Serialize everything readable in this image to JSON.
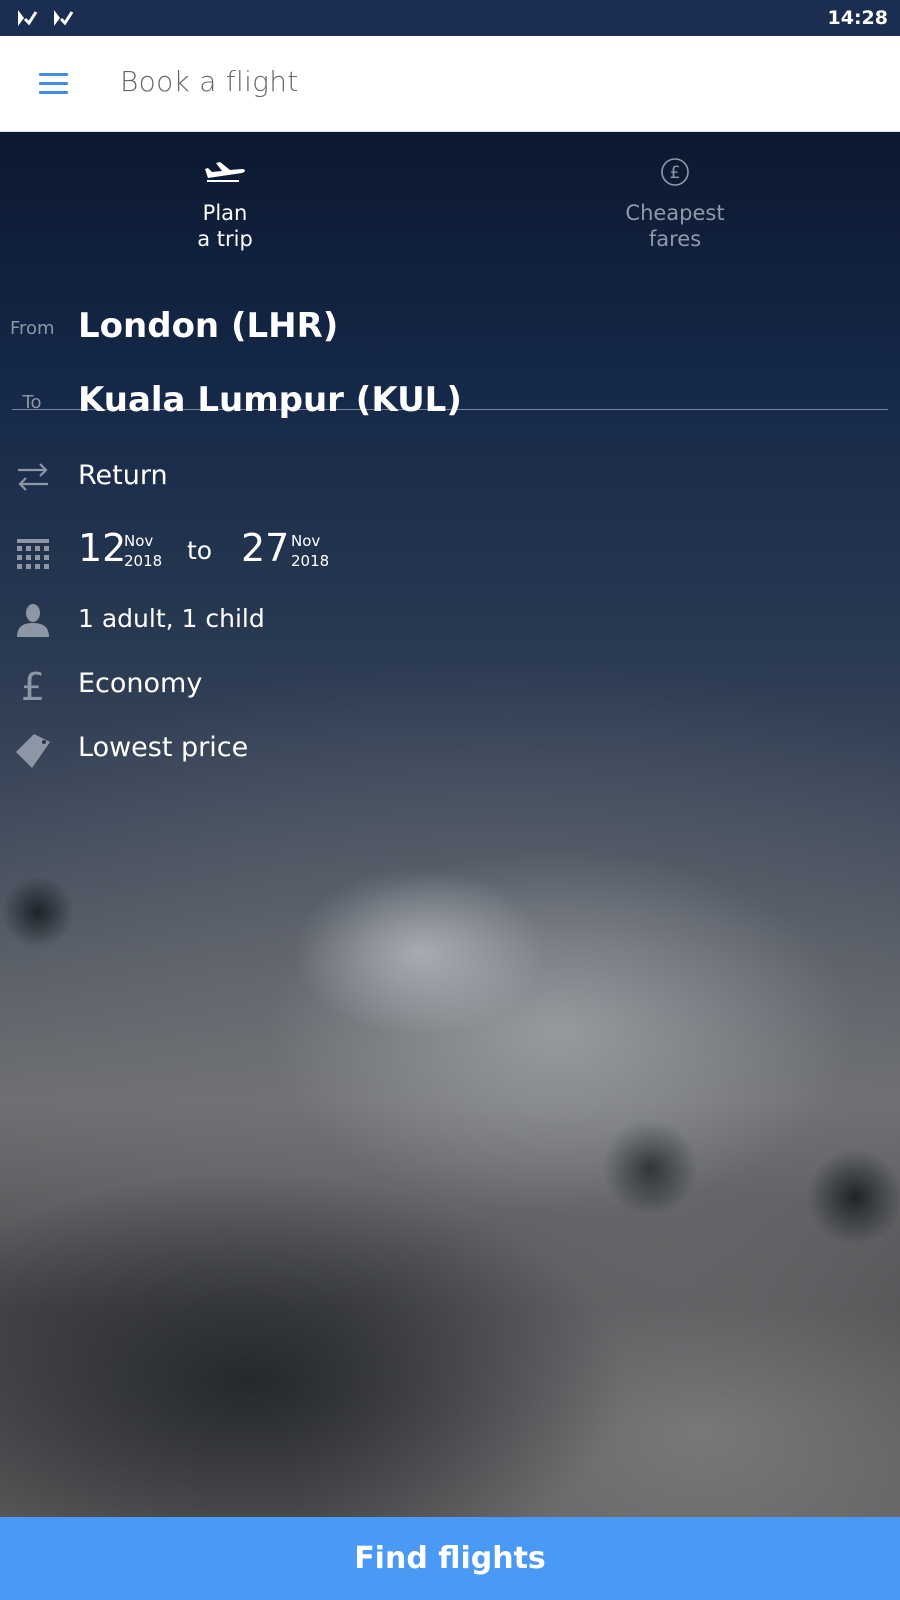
{
  "status_bar": {
    "time": "14:28",
    "notification_icons": [
      "airline-notification-icon",
      "airline-notification-icon"
    ]
  },
  "app_bar": {
    "title": "Book a flight",
    "menu_icon": "hamburger-menu-icon",
    "accent_color": "#3d8de6"
  },
  "tabs": [
    {
      "label": "Plan\na trip",
      "icon": "airplane-icon",
      "active": true
    },
    {
      "label": "Cheapest\nfares",
      "icon": "pound-circle-icon",
      "active": false
    }
  ],
  "form": {
    "from": {
      "label": "From",
      "value": "London (LHR)"
    },
    "to": {
      "label": "To",
      "value": "Kuala Lumpur (KUL)"
    },
    "trip_type": {
      "icon": "swap-arrows-icon",
      "value": "Return"
    },
    "dates": {
      "icon": "calendar-icon",
      "depart": {
        "day": "12",
        "month": "Nov",
        "year": "2018"
      },
      "separator": "to",
      "return": {
        "day": "27",
        "month": "Nov",
        "year": "2018"
      }
    },
    "passengers": {
      "icon": "person-icon",
      "value": "1 adult, 1 child"
    },
    "cabin": {
      "icon": "pound-icon",
      "value": "Economy"
    },
    "sort": {
      "icon": "tag-icon",
      "value": "Lowest price"
    }
  },
  "find_button": {
    "label": "Find flights",
    "color": "#4a99f5"
  }
}
